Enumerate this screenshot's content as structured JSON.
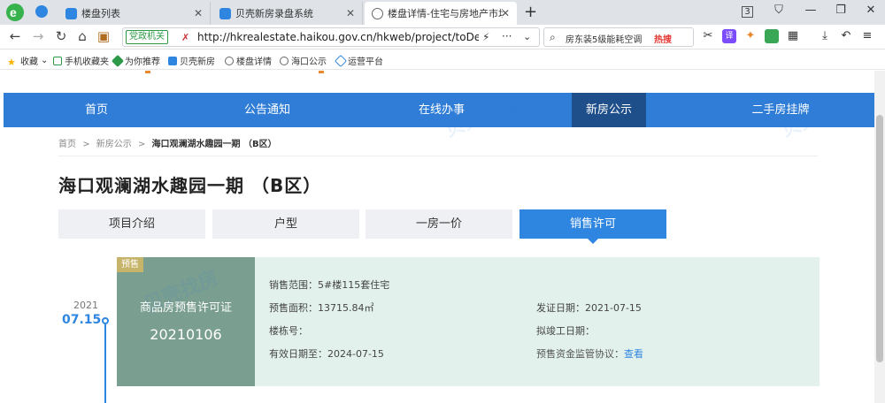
{
  "browser": {
    "tabs": [
      {
        "label": "楼盘列表",
        "icon": "blue-page-icon",
        "active": false
      },
      {
        "label": "贝壳新房录盘系统",
        "icon": "blue-page-icon",
        "active": false
      },
      {
        "label": "楼盘详情-住宅与房地产市场信",
        "icon": "globe-icon",
        "active": true
      }
    ],
    "gov_badge": "党政机关",
    "url": "http://hkrealestate.haikou.gov.cn/hkweb/project/toDetail?u",
    "search_text": "房东装5级能耗空调",
    "search_hot": "热搜",
    "tab_count": "3",
    "bookmarks": [
      {
        "label": "收藏"
      },
      {
        "label": "手机收藏夹"
      },
      {
        "label": "为你推荐"
      },
      {
        "label": "贝壳新房"
      },
      {
        "label": "楼盘详情"
      },
      {
        "label": "海口公示"
      },
      {
        "label": "运营平台"
      }
    ]
  },
  "nav": {
    "items": [
      "首页",
      "公告通知",
      "在线办事",
      "新房公示",
      "二手房挂牌"
    ],
    "active": "新房公示"
  },
  "breadcrumb": {
    "home": "首页",
    "sep": ">",
    "section": "新房公示",
    "current": "海口观澜湖水趣园一期 （B区）"
  },
  "project_title": "海口观澜湖水趣园一期 （B区）",
  "subtabs": [
    "项目介绍",
    "户型",
    "一房一价",
    "销售许可"
  ],
  "subtab_active": "销售许可",
  "timeline": {
    "year": "2021",
    "day": "07.15"
  },
  "permit": {
    "badge": "预售",
    "label": "商品房预售许可证",
    "number": "20210106",
    "fields": {
      "scope": "销售范围：5#楼115套住宅",
      "area": "预售面积：13715.84㎡",
      "building": "楼栋号：",
      "valid_until": "有效日期至：2024-07-15",
      "issue_date": "发证日期：2021-07-15",
      "planned_completion": "拟竣工日期：",
      "supervision_label": "预售资金监管协议：",
      "supervision_link": "查看"
    }
  },
  "watermark": "贝壳找房"
}
